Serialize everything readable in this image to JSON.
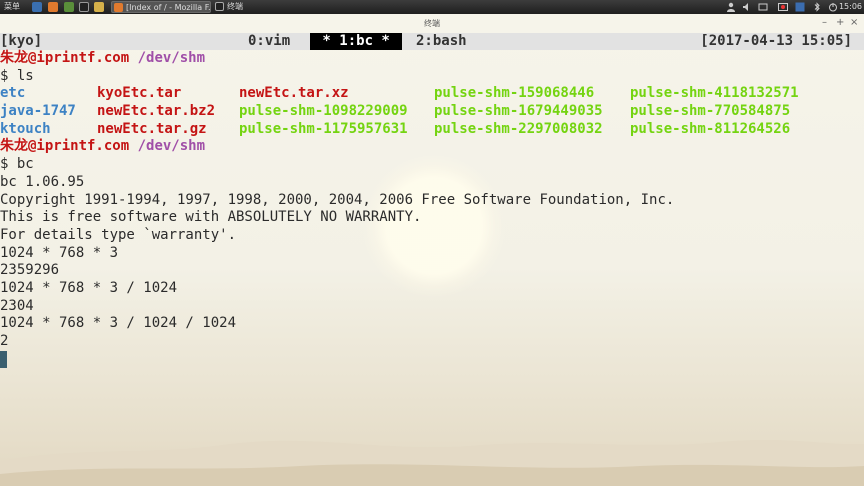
{
  "panel": {
    "menu_label": "菜单",
    "tasks": [
      {
        "label": "[Index of / - Mozilla F...",
        "icon": "firefox-icon"
      },
      {
        "label": "终端",
        "icon": "terminal-icon"
      }
    ],
    "clock": "15:06"
  },
  "window": {
    "title": "终端"
  },
  "tmux": {
    "session": "[kyo]",
    "windows": [
      {
        "label": "0:vim",
        "active": false
      },
      {
        "label": " * 1:bc * ",
        "active": true
      },
      {
        "label": "2:bash",
        "active": false
      }
    ],
    "datetime": "[2017-04-13 15:05]"
  },
  "terminal": {
    "prompt_user": "朱龙@iprintf.com",
    "prompt_dir": "/dev/shm",
    "cmd_ls": "$ ls",
    "ls_rows": [
      [
        {
          "text": "etc",
          "color": "blue"
        },
        {
          "text": "kyoEtc.tar",
          "color": "red"
        },
        {
          "text": "newEtc.tar.xz",
          "color": "red"
        },
        {
          "text": "pulse-shm-159068446",
          "color": "green"
        },
        {
          "text": "pulse-shm-4118132571",
          "color": "green"
        }
      ],
      [
        {
          "text": "java-1747",
          "color": "blue"
        },
        {
          "text": "newEtc.tar.bz2",
          "color": "red"
        },
        {
          "text": "pulse-shm-1098229009",
          "color": "green"
        },
        {
          "text": "pulse-shm-1679449035",
          "color": "green"
        },
        {
          "text": "pulse-shm-770584875",
          "color": "green"
        }
      ],
      [
        {
          "text": "ktouch",
          "color": "blue"
        },
        {
          "text": "newEtc.tar.gz",
          "color": "red"
        },
        {
          "text": "pulse-shm-1175957631",
          "color": "green"
        },
        {
          "text": "pulse-shm-2297008032",
          "color": "green"
        },
        {
          "text": "pulse-shm-811264526",
          "color": "green"
        }
      ]
    ],
    "cmd_bc": "$ bc",
    "output": [
      "bc 1.06.95",
      "Copyright 1991-1994, 1997, 1998, 2000, 2004, 2006 Free Software Foundation, Inc.",
      "This is free software with ABSOLUTELY NO WARRANTY.",
      "For details type `warranty'.",
      "1024 * 768 * 3",
      "2359296",
      "1024 * 768 * 3 / 1024",
      "2304",
      "1024 * 768 * 3 / 1024 / 1024",
      "2"
    ]
  },
  "colors": {
    "blue": "#3d82c4",
    "red": "#c41414",
    "green": "#74d410",
    "purple": "#a04fa8"
  }
}
